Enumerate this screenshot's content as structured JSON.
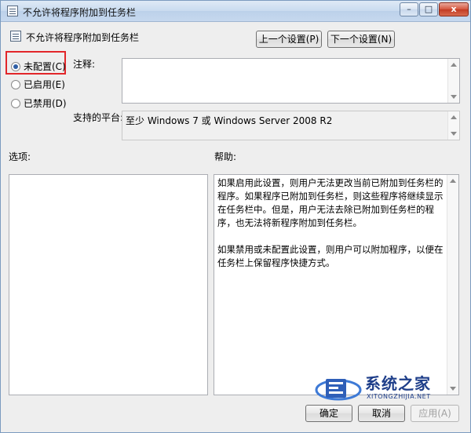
{
  "window": {
    "title": "不允许将程序附加到任务栏",
    "controls": {
      "minimize": "–",
      "maximize": "□",
      "close": "x"
    }
  },
  "header": {
    "policy_name": "不允许将程序附加到任务栏",
    "prev_button": "上一个设置(P)",
    "next_button": "下一个设置(N)"
  },
  "state": {
    "options": [
      {
        "label": "未配置(C)",
        "selected": true
      },
      {
        "label": "已启用(E)",
        "selected": false
      },
      {
        "label": "已禁用(D)",
        "selected": false
      }
    ]
  },
  "comment": {
    "label": "注释:",
    "value": ""
  },
  "platform": {
    "label": "支持的平台:",
    "value": "至少 Windows 7 或 Windows Server 2008 R2"
  },
  "options_section": {
    "label": "选项:"
  },
  "help_section": {
    "label": "帮助:",
    "paragraphs": [
      "如果启用此设置，则用户无法更改当前已附加到任务栏的程序。如果程序已附加到任务栏，则这些程序将继续显示在任务栏中。但是，用户无法去除已附加到任务栏的程序，也无法将新程序附加到任务栏。",
      "如果禁用或未配置此设置，则用户可以附加程序，以便在任务栏上保留程序快捷方式。"
    ]
  },
  "footer": {
    "ok_button": "确定",
    "cancel_button": "取消",
    "apply_button": "应用(A)",
    "apply_enabled": false
  },
  "watermark": {
    "title": "系统之家",
    "url": "XITONGZHIJIA.NET"
  },
  "colors": {
    "highlight": "#e2262a",
    "title_gradient_top": "#dfeaf6",
    "watermark": "#1f3f8a"
  }
}
